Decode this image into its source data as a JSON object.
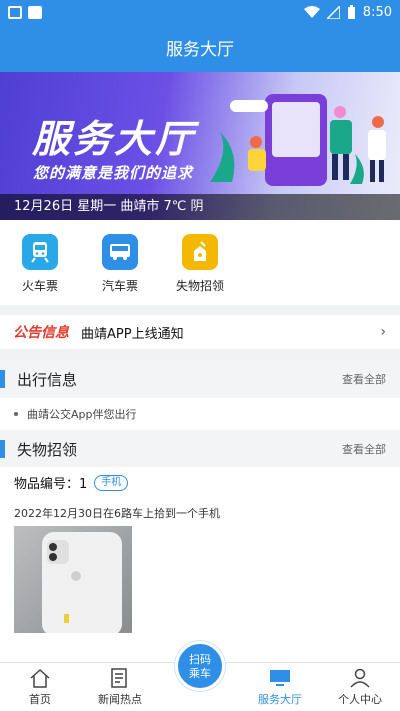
{
  "status": {
    "time": "8:50"
  },
  "header": {
    "title": "服务大厅"
  },
  "banner": {
    "headline": "服务大厅",
    "slogan": "您的满意是我们的追求",
    "date_line": "12月26日 星期一 曲靖市 7℃ 阴"
  },
  "quick_menu": [
    {
      "label": "火车票",
      "icon": "train-icon",
      "color": "#29a8e8"
    },
    {
      "label": "汽车票",
      "icon": "bus-icon",
      "color": "#2f8fe6"
    },
    {
      "label": "失物招领",
      "icon": "lost-found-icon",
      "color": "#f5b800"
    }
  ],
  "notice": {
    "tag": "公告信息",
    "text": "曲靖APP上线通知"
  },
  "travel": {
    "title": "出行信息",
    "more": "查看全部",
    "item": "曲靖公交App伴您出行"
  },
  "lost": {
    "title": "失物招领",
    "more": "查看全部",
    "item_no_label": "物品编号：1",
    "category": "手机",
    "description": "2022年12月30日在6路车上拾到一个手机"
  },
  "scan_button": {
    "line1": "扫码",
    "line2": "乘车"
  },
  "bottom_nav": [
    {
      "label": "首页",
      "icon": "home-icon"
    },
    {
      "label": "新闻热点",
      "icon": "news-icon"
    },
    {
      "label": "",
      "icon": ""
    },
    {
      "label": "服务大厅",
      "icon": "monitor-icon",
      "active": true
    },
    {
      "label": "个人中心",
      "icon": "person-icon"
    }
  ],
  "colors": {
    "primary": "#2f8fe6",
    "notice_red": "#e23b2b"
  }
}
